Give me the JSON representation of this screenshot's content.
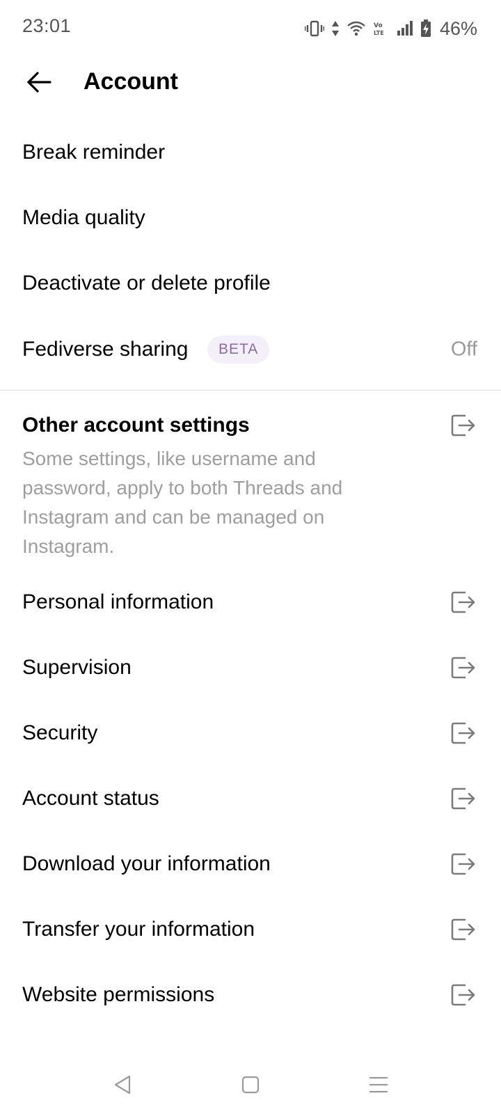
{
  "status_bar": {
    "time": "23:01",
    "battery_percent": "46%",
    "icons": [
      "vibrate-icon",
      "data-arrows-icon",
      "wifi-icon",
      "volte-icon",
      "signal-icon",
      "battery-icon"
    ]
  },
  "header": {
    "title": "Account",
    "back_icon": "arrow-left-icon"
  },
  "settings": {
    "break_reminder": "Break reminder",
    "media_quality": "Media quality",
    "deactivate": "Deactivate or delete profile",
    "fediverse": {
      "label": "Fediverse sharing",
      "badge": "BETA",
      "value": "Off"
    }
  },
  "other_account_settings": {
    "title": "Other account settings",
    "description": "Some settings, like username and password, apply to both Threads and Instagram and can be managed on Instagram.",
    "icon": "external-link-icon"
  },
  "links": [
    {
      "label": "Personal information",
      "icon": "external-link-icon"
    },
    {
      "label": "Supervision",
      "icon": "external-link-icon"
    },
    {
      "label": "Security",
      "icon": "external-link-icon"
    },
    {
      "label": "Account status",
      "icon": "external-link-icon"
    },
    {
      "label": "Download your information",
      "icon": "external-link-icon"
    },
    {
      "label": "Transfer your information",
      "icon": "external-link-icon"
    },
    {
      "label": "Website permissions",
      "icon": "external-link-icon"
    }
  ],
  "nav_bar": {
    "icons": [
      "nav-back-icon",
      "nav-home-icon",
      "nav-menu-icon"
    ]
  },
  "colors": {
    "text_primary": "#000000",
    "text_secondary": "#9e9e9e",
    "badge_bg": "#f4f0fa",
    "badge_text": "#8a6ab0",
    "divider": "#dcdcdc",
    "icon_gray": "#7a7a7a"
  }
}
